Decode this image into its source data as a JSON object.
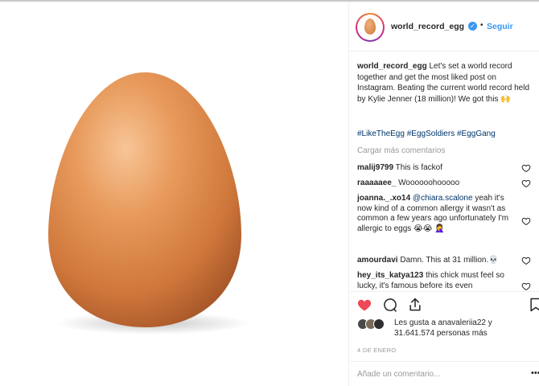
{
  "post": {
    "username": "world_record_egg",
    "verified_mark": "✓",
    "separator": "•",
    "follow_label": "Seguir",
    "caption_user": "world_record_egg",
    "caption_text": "Let's set a world record together and get the most liked post on Instagram. Beating the current world record held by Kylie Jenner (18 million)! We got this 🙌",
    "hashtags": "#LikeTheEgg #EggSoldiers #EggGang",
    "load_more": "Cargar más comentarios",
    "likes_line1": "Les gusta a anavaleriia22 y",
    "likes_line2": "31.641.574 personas más",
    "date": "4 DE ENERO",
    "add_comment_placeholder": "Añade un comentario...",
    "more_glyph": "•••"
  },
  "comments": [
    {
      "user": "malij9799",
      "text": "This is fackof"
    },
    {
      "user": "raaaaaee_",
      "text": "Woooooohooooo"
    },
    {
      "user": "joanna._.xo14",
      "mention": "@chiara.scalone",
      "text": "yeah it's now kind of a common allergy it wasn't as common a few years ago unfortunately I'm allergic to eggs 😭😭 🤦‍♀️"
    },
    {
      "user": "amourdavi",
      "text": "Damn. This at 31 million.💀"
    },
    {
      "user": "hey_its_katya123",
      "text": "this chick must feel so lucky, it's famous before its even"
    }
  ],
  "colors": {
    "link_blue": "#3897f0",
    "hashtag": "#003569",
    "like_red": "#ed4956",
    "muted": "#999999"
  },
  "icons": [
    "heart-filled-icon",
    "comment-icon",
    "share-icon",
    "bookmark-icon",
    "heart-outline-icon",
    "verified-badge-icon"
  ]
}
